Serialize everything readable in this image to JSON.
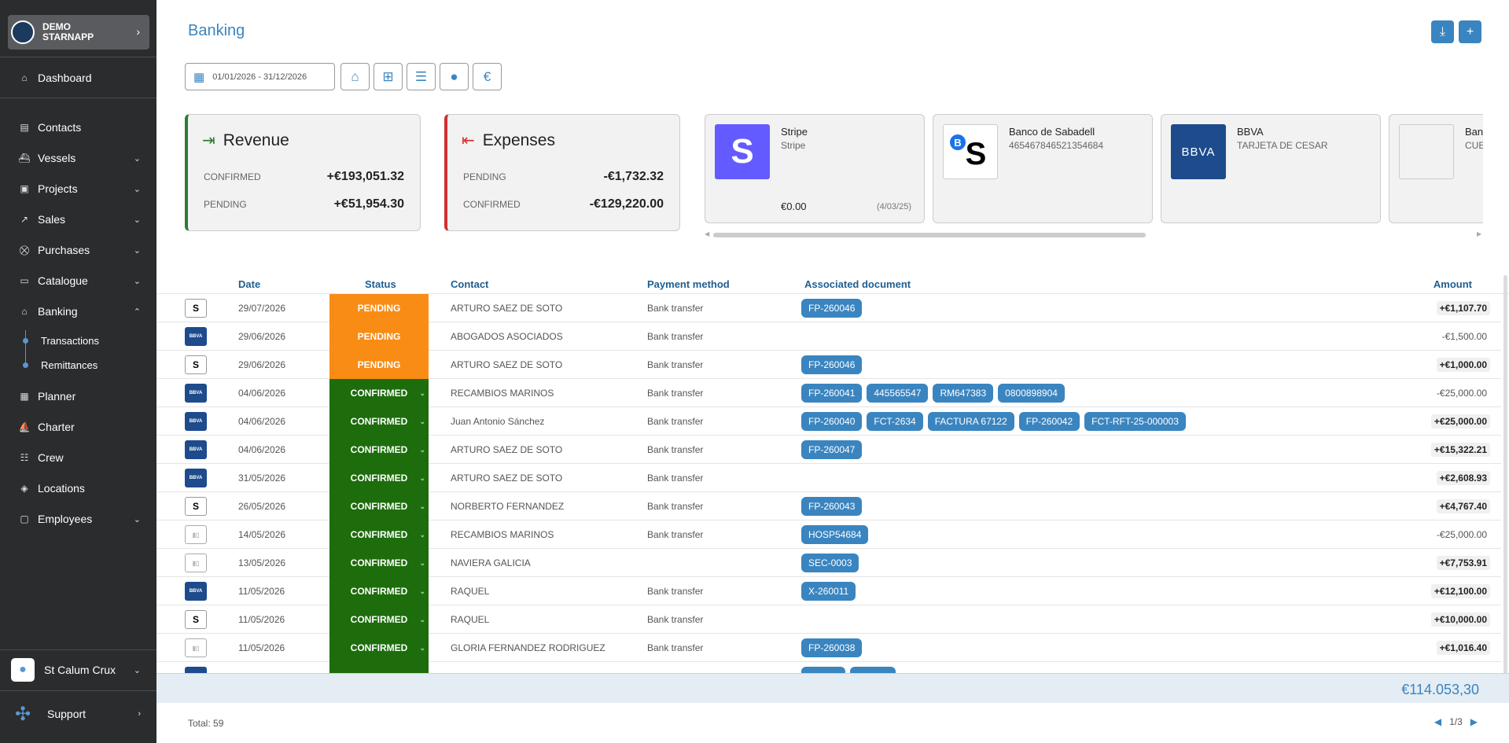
{
  "sidebar": {
    "org": {
      "name": "DEMO STARNAPP"
    },
    "nav": [
      {
        "label": "Dashboard",
        "icon": "home-icon"
      },
      {
        "label": "Contacts",
        "icon": "contacts-icon"
      },
      {
        "label": "Vessels",
        "icon": "ship-icon"
      },
      {
        "label": "Projects",
        "icon": "projects-icon"
      },
      {
        "label": "Sales",
        "icon": "chart-line-icon"
      },
      {
        "label": "Purchases",
        "icon": "cart-icon"
      },
      {
        "label": "Catalogue",
        "icon": "book-icon"
      },
      {
        "label": "Banking",
        "icon": "bank-icon"
      }
    ],
    "banking_sub": [
      "Transactions",
      "Remittances"
    ],
    "nav2": [
      {
        "label": "Planner",
        "icon": "calendar-icon"
      },
      {
        "label": "Charter",
        "icon": "sailboat-icon"
      },
      {
        "label": "Crew",
        "icon": "users-icon"
      },
      {
        "label": "Locations",
        "icon": "location-icon"
      },
      {
        "label": "Employees",
        "icon": "briefcase-icon"
      }
    ],
    "user": "St Calum Crux",
    "support": "Support"
  },
  "page": {
    "title": "Banking"
  },
  "filters": {
    "date_range": "01/01/2026 - 31/12/2026"
  },
  "summary": {
    "revenue": {
      "title": "Revenue",
      "row1_label": "CONFIRMED",
      "row1_value": "+€193,051.32",
      "row2_label": "PENDING",
      "row2_value": "+€51,954.30",
      "color": "#2e7d32"
    },
    "expenses": {
      "title": "Expenses",
      "row1_label": "PENDING",
      "row1_value": "-€1,732.32",
      "row2_label": "CONFIRMED",
      "row2_value": "-€129,220.00",
      "color": "#d32f2f"
    }
  },
  "accounts": [
    {
      "name": "Stripe",
      "sub": "Stripe",
      "balance": "€0.00",
      "date": "(4/03/25)"
    },
    {
      "name": "Banco de Sabadell",
      "sub": "465467846521354684"
    },
    {
      "name": "BBVA",
      "sub": "TARJETA DE CESAR"
    },
    {
      "name": "Banc",
      "sub": "CUE"
    }
  ],
  "table": {
    "headers": {
      "date": "Date",
      "status": "Status",
      "contact": "Contact",
      "method": "Payment method",
      "doc": "Associated document",
      "amount": "Amount"
    },
    "rows": [
      {
        "bank": "sab",
        "date": "29/07/2026",
        "status": "PENDING",
        "contact": "ARTURO SAEZ DE SOTO",
        "method": "Bank transfer",
        "docs": [
          "FP-260046"
        ],
        "amount": "+€1,107.70",
        "pos": true
      },
      {
        "bank": "bbva",
        "date": "29/06/2026",
        "status": "PENDING",
        "contact": "ABOGADOS ASOCIADOS",
        "method": "Bank transfer",
        "docs": [],
        "amount": "-€1,500.00",
        "pos": false
      },
      {
        "bank": "sab",
        "date": "29/06/2026",
        "status": "PENDING",
        "contact": "ARTURO SAEZ DE SOTO",
        "method": "Bank transfer",
        "docs": [
          "FP-260046"
        ],
        "amount": "+€1,000.00",
        "pos": true
      },
      {
        "bank": "bbva",
        "date": "04/06/2026",
        "status": "CONFIRMED",
        "contact": "RECAMBIOS MARINOS",
        "method": "Bank transfer",
        "docs": [
          "FP-260041",
          "445565547",
          "RM647383",
          "0800898904"
        ],
        "amount": "-€25,000.00",
        "pos": false
      },
      {
        "bank": "bbva",
        "date": "04/06/2026",
        "status": "CONFIRMED",
        "contact": "Juan Antonio Sánchez",
        "method": "Bank transfer",
        "docs": [
          "FP-260040",
          "FCT-2634",
          "FACTURA 67122",
          "FP-260042",
          "FCT-RFT-25-000003"
        ],
        "amount": "+€25,000.00",
        "pos": true
      },
      {
        "bank": "bbva",
        "date": "04/06/2026",
        "status": "CONFIRMED",
        "contact": "ARTURO SAEZ DE SOTO",
        "method": "Bank transfer",
        "docs": [
          "FP-260047"
        ],
        "amount": "+€15,322.21",
        "pos": true
      },
      {
        "bank": "bbva",
        "date": "31/05/2026",
        "status": "CONFIRMED",
        "contact": "ARTURO SAEZ DE SOTO",
        "method": "Bank transfer",
        "docs": [],
        "amount": "+€2,608.93",
        "pos": true
      },
      {
        "bank": "sab",
        "date": "26/05/2026",
        "status": "CONFIRMED",
        "contact": "NORBERTO FERNANDEZ",
        "method": "Bank transfer",
        "docs": [
          "FP-260043"
        ],
        "amount": "+€4,767.40",
        "pos": true
      },
      {
        "bank": "gen",
        "date": "14/05/2026",
        "status": "CONFIRMED",
        "contact": "RECAMBIOS MARINOS",
        "method": "Bank transfer",
        "docs": [
          "HOSP54684"
        ],
        "amount": "-€25,000.00",
        "pos": false
      },
      {
        "bank": "gen",
        "date": "13/05/2026",
        "status": "CONFIRMED",
        "contact": "NAVIERA GALICIA",
        "method": "",
        "docs": [
          "SEC-0003"
        ],
        "amount": "+€7,753.91",
        "pos": true
      },
      {
        "bank": "bbva",
        "date": "11/05/2026",
        "status": "CONFIRMED",
        "contact": "RAQUEL",
        "method": "Bank transfer",
        "docs": [
          "X-260011"
        ],
        "amount": "+€12,100.00",
        "pos": true
      },
      {
        "bank": "sab",
        "date": "11/05/2026",
        "status": "CONFIRMED",
        "contact": "RAQUEL",
        "method": "Bank transfer",
        "docs": [],
        "amount": "+€10,000.00",
        "pos": true
      },
      {
        "bank": "gen",
        "date": "11/05/2026",
        "status": "CONFIRMED",
        "contact": "GLORIA FERNANDEZ RODRIGUEZ",
        "method": "Bank transfer",
        "docs": [
          "FP-260038"
        ],
        "amount": "+€1,016.40",
        "pos": true
      }
    ]
  },
  "footer": {
    "total_amount": "€114.053,30",
    "total_count": "Total: 59",
    "page": "1/3"
  }
}
